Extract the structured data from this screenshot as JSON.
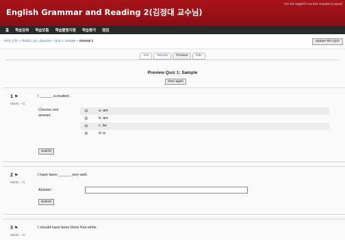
{
  "header": {
    "title": "English Grammar and Reading 2(김정대 교수님)",
    "login_info": "You are logged in as Kim Jungtae (Logout)"
  },
  "nav": [
    "홈",
    "학습강좌",
    "학습모둠",
    "학습활동지원",
    "학습평가",
    "점검"
  ],
  "breadcrumb": {
    "trail": "POS_CTL » TESOL_22 » Quizzes » Quiz 1: Sample » ",
    "current": "Attempt 1"
  },
  "update_button": "Update this Quiz",
  "tabs": [
    "Info",
    "Results",
    "Preview",
    "Edit"
  ],
  "preview_title": "Preview Quiz 1: Sample",
  "start_again": "Start again",
  "questions": [
    {
      "number": "1",
      "marks": "Marks: --/1",
      "text": "I ______ a student.",
      "choose_label": "Choose one answer.",
      "choices": [
        "a. am",
        "b. are",
        "c. be",
        "d. is"
      ],
      "submit": "Submit"
    },
    {
      "number": "2",
      "marks": "Marks: --/1",
      "text": "I have been ______ very well.",
      "answer_label": "Answer:",
      "submit": "Submit"
    },
    {
      "number": "3",
      "marks": "Marks: --/1",
      "text": "I should have been there fora while."
    }
  ],
  "flag_icon": "flag-icon",
  "colors": {
    "header_red": "#9a1118",
    "nav_dark": "#2a2a2a",
    "link_blue": "#3a5ea8",
    "choice_stripe": "#ececec"
  }
}
